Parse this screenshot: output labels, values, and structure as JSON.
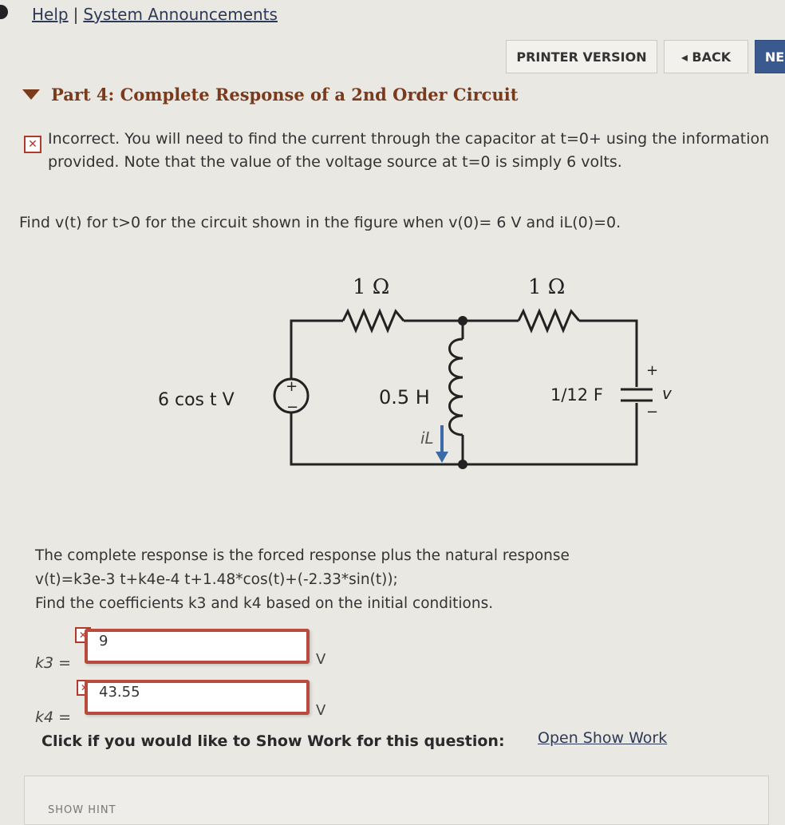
{
  "nav": {
    "help": "Help",
    "separator": "|",
    "announcements": "System Announcements"
  },
  "toolbar": {
    "printer": "PRINTER VERSION",
    "back": "◂ BACK",
    "next": "NE"
  },
  "part": {
    "title": "Part 4: Complete Response of a 2nd Order Circuit"
  },
  "feedback": {
    "icon": "incorrect-icon",
    "text": "Incorrect. You will need to find the current through the capacitor at t=0+ using the information provided. Note that the value of the voltage source at t=0 is simply 6 volts."
  },
  "question": {
    "text": "Find v(t) for t>0 for the circuit shown in the figure when v(0)= 6 V and iL(0)=0."
  },
  "circuit": {
    "r1": "1 Ω",
    "r2": "1 Ω",
    "source": "6 cos t V",
    "inductor": "0.5 H",
    "current": "iL",
    "capacitor": "1/12 F",
    "plus": "+",
    "minus": "−",
    "voltage": "v"
  },
  "response": {
    "line1": "The complete response is the forced response plus the natural response",
    "line2": "v(t)=k3e-3 t+k4e-4 t+1.48*cos(t)+(-2.33*sin(t));",
    "line3": "Find the coefficients k3 and k4 based on the initial conditions."
  },
  "answers": {
    "k3_label": "k3 =",
    "k3_value": "9",
    "k3_unit": "V",
    "k4_label": "k4 =",
    "k4_value": "43.55",
    "k4_unit": "V"
  },
  "work": {
    "prompt": "Click if you would like to Show Work for this question:",
    "link": "Open Show Work"
  },
  "hint": "SHOW HINT",
  "colors": {
    "incorrect": "#b84a3e",
    "title": "#7a3a1c",
    "link": "#2e3a55"
  }
}
